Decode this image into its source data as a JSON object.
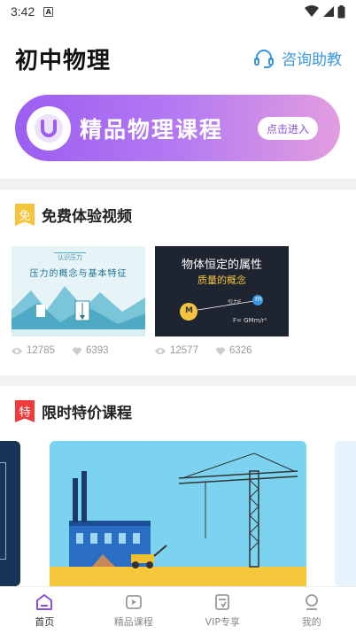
{
  "status": {
    "time": "3:42",
    "notif": "A"
  },
  "header": {
    "title": "初中物理",
    "consult_label": "咨询助教"
  },
  "banner": {
    "title": "精品物理课程",
    "button": "点击进入"
  },
  "free": {
    "badge": "免",
    "title": "免费体验视频",
    "cards": [
      {
        "tag": "认识压力",
        "title": "压力的概念与基本特征",
        "views": "12785",
        "likes": "6393"
      },
      {
        "title": "物体恒定的属性",
        "subtitle": "质量的概念",
        "label_f": "引力F",
        "formula": "F= GMm/r²",
        "m_big": "M",
        "m_small": "m",
        "views": "12577",
        "likes": "6326"
      }
    ]
  },
  "sale": {
    "badge": "特",
    "title": "限时特价课程"
  },
  "nav": [
    {
      "label": "首页",
      "icon": "home-icon"
    },
    {
      "label": "精品课程",
      "icon": "video-icon"
    },
    {
      "label": "VIP专享",
      "icon": "document-icon"
    },
    {
      "label": "我的",
      "icon": "profile-icon"
    }
  ],
  "colors": {
    "accent": "#3b96e0",
    "banner_start": "#9c5ef0",
    "banner_end": "#e39de0"
  }
}
